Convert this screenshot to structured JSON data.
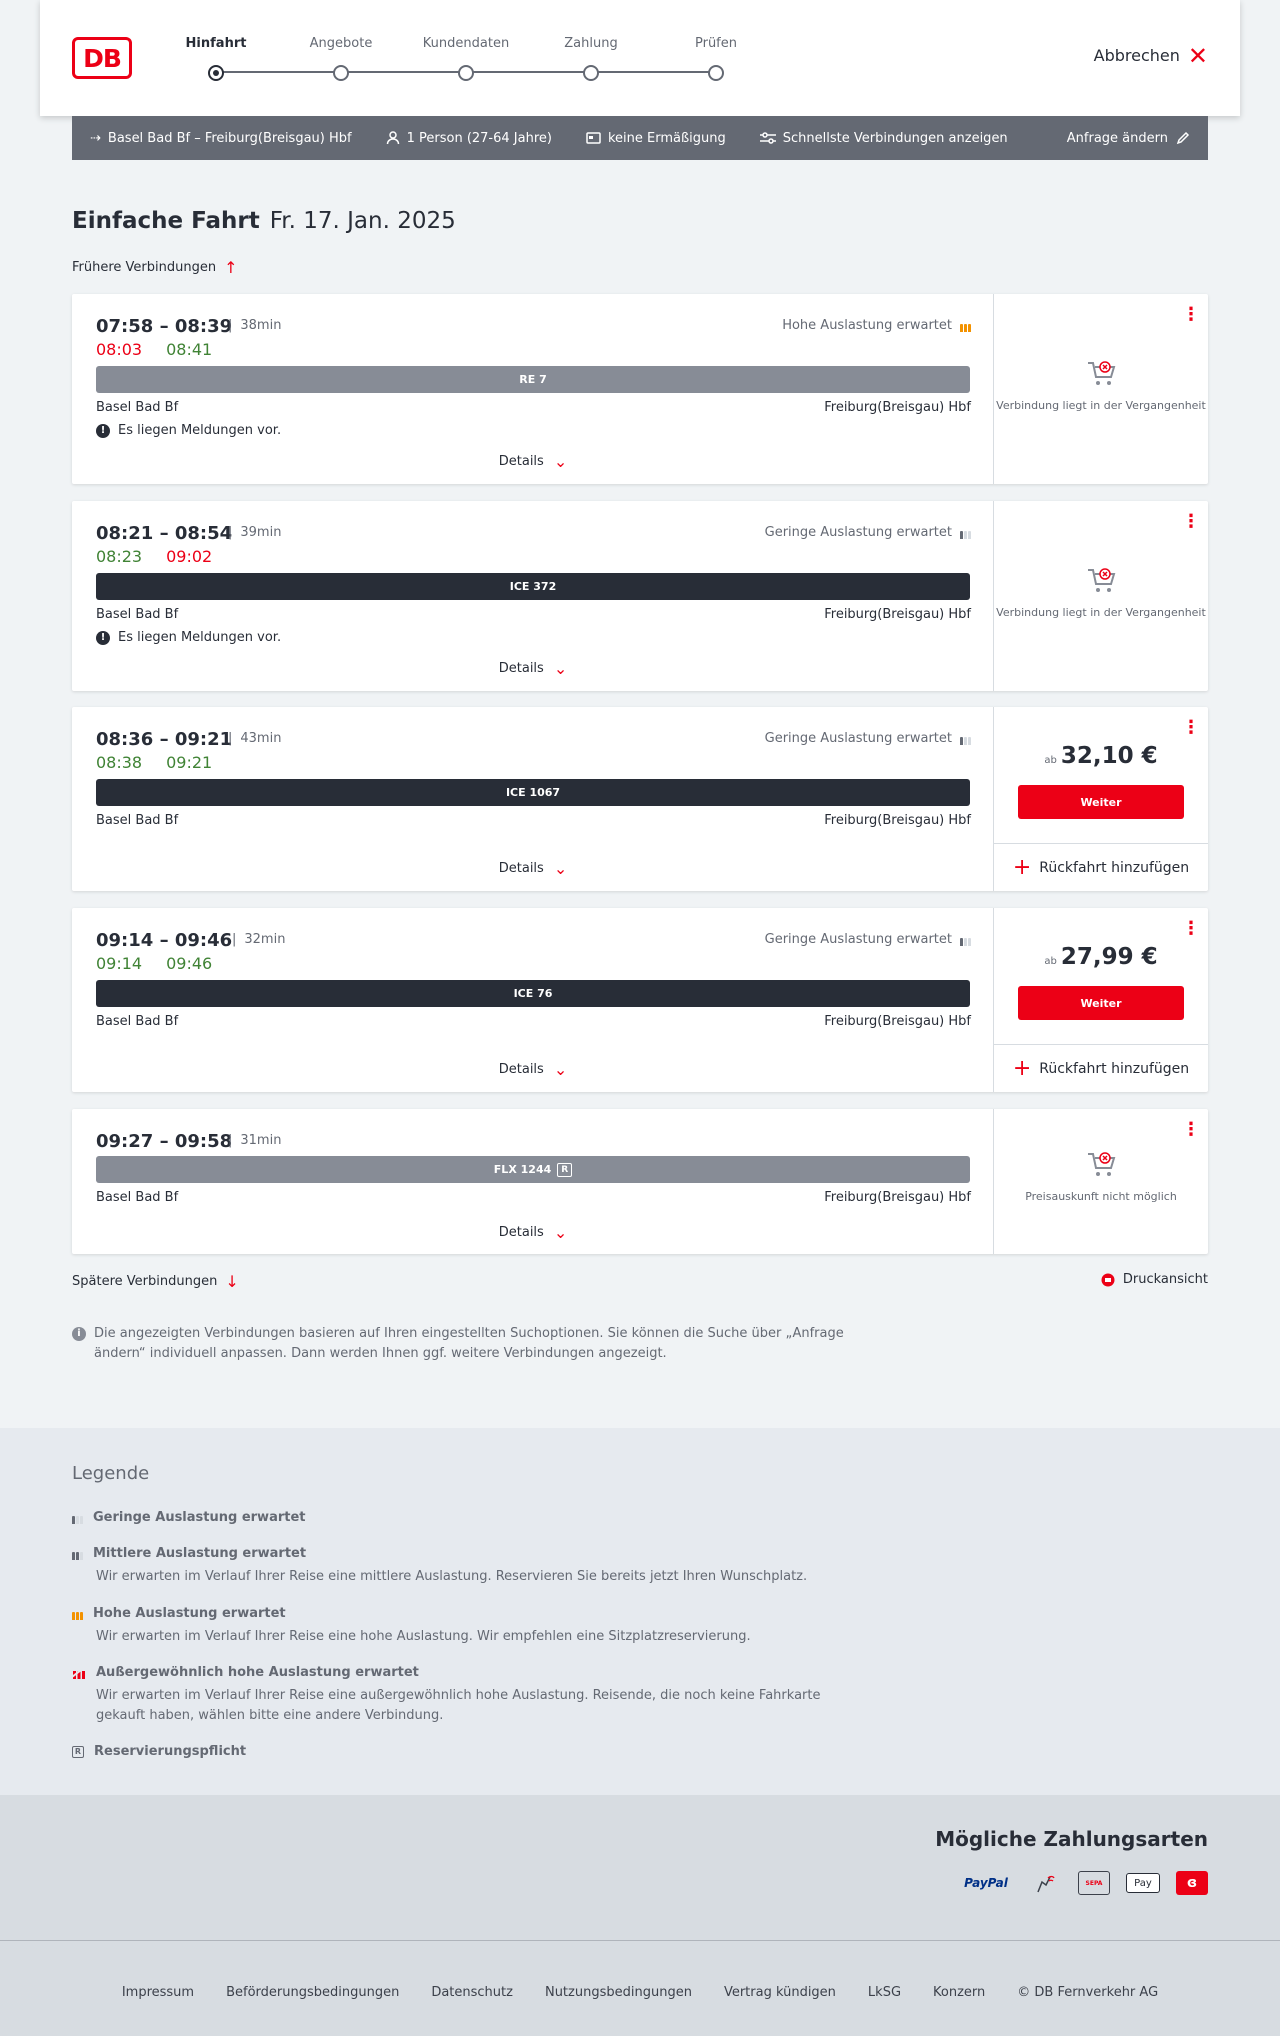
{
  "header": {
    "logo": "DB",
    "steps": [
      "Hinfahrt",
      "Angebote",
      "Kundendaten",
      "Zahlung",
      "Prüfen"
    ],
    "active_step": 0,
    "cancel_label": "Abbrechen"
  },
  "search": {
    "route": "Basel Bad Bf – Freiburg(Breisgau) Hbf",
    "passengers": "1 Person (27-64 Jahre)",
    "discount": "keine Ermäßigung",
    "fastest": "Schnellste Verbindungen anzeigen",
    "edit": "Anfrage ändern"
  },
  "title": {
    "type": "Einfache Fahrt",
    "date": "Fr. 17. Jan. 2025"
  },
  "earlier_label": "Frühere Verbindungen",
  "later_label": "Spätere Verbindungen",
  "print_label": "Druckansicht",
  "details_label": "Details",
  "message_label": "Es liegen Meldungen vor.",
  "from": "Basel Bad Bf",
  "to": "Freiburg(Breisgau) Hbf",
  "past_label": "Verbindung liegt in der Vergangenheit",
  "no_price_label": "Preisauskunft nicht möglich",
  "weiter_label": "Weiter",
  "ab_label": "ab",
  "rueck_label": "Rückfahrt hinzufügen",
  "connections": [
    {
      "time": "07:58 – 08:39",
      "duration": "38min",
      "rt_dep": "08:03",
      "rt_arr": "08:41",
      "load": "Hohe Auslastung erwartet",
      "train": "RE 7"
    },
    {
      "time": "08:21 – 08:54",
      "duration": "39min",
      "rt_dep": "08:23",
      "rt_arr": "09:02",
      "load": "Geringe Auslastung erwartet",
      "train": "ICE 372"
    },
    {
      "time": "08:36 – 09:21",
      "duration": "43min",
      "rt_dep": "08:38",
      "rt_arr": "09:21",
      "load": "Geringe Auslastung erwartet",
      "train": "ICE 1067",
      "price": "32,10 €"
    },
    {
      "time": "09:14 – 09:46",
      "duration": "32min",
      "rt_dep": "09:14",
      "rt_arr": "09:46",
      "load": "Geringe Auslastung erwartet",
      "train": "ICE 76",
      "price": "27,99 €"
    },
    {
      "time": "09:27 – 09:58",
      "duration": "31min",
      "train": "FLX 1244",
      "reservation": "R"
    }
  ],
  "info_text": "Die angezeigten Verbindungen basieren auf Ihren eingestellten Suchoptionen. Sie können die Suche über „Anfrage ändern“ individuell anpassen. Dann werden Ihnen ggf. weitere Verbindungen angezeigt.",
  "legend": {
    "title": "Legende",
    "items": [
      {
        "title": "Geringe Auslastung erwartet",
        "desc": ""
      },
      {
        "title": "Mittlere Auslastung erwartet",
        "desc": "Wir erwarten im Verlauf Ihrer Reise eine mittlere Auslastung. Reservieren Sie bereits jetzt Ihren Wunschplatz."
      },
      {
        "title": "Hohe Auslastung erwartet",
        "desc": "Wir erwarten im Verlauf Ihrer Reise eine hohe Auslastung. Wir empfehlen eine Sitzplatzreservierung."
      },
      {
        "title": "Außergewöhnlich hohe Auslastung erwartet",
        "desc": "Wir erwarten im Verlauf Ihrer Reise eine außergewöhnlich hohe Auslastung. Reisende, die noch keine Fahrkarte gekauft haben, wählen bitte eine andere Verbindung."
      },
      {
        "title": "Reservierungspflicht",
        "desc": ""
      }
    ]
  },
  "payment": {
    "title": "Mögliche Zahlungsarten",
    "paypal": "PayPal",
    "sepa": "SEPA",
    "applepay": "Pay"
  },
  "footer": [
    "Impressum",
    "Beförderungsbedingungen",
    "Datenschutz",
    "Nutzungsbedingungen",
    "Vertrag kündigen",
    "LkSG",
    "Konzern",
    "© DB Fernverkehr AG"
  ],
  "colors": {
    "brand_red": "#ec0016",
    "ontime_green": "#408335",
    "dark": "#282d37",
    "bar_grey": "#878c96",
    "high_load": "#f39200"
  }
}
